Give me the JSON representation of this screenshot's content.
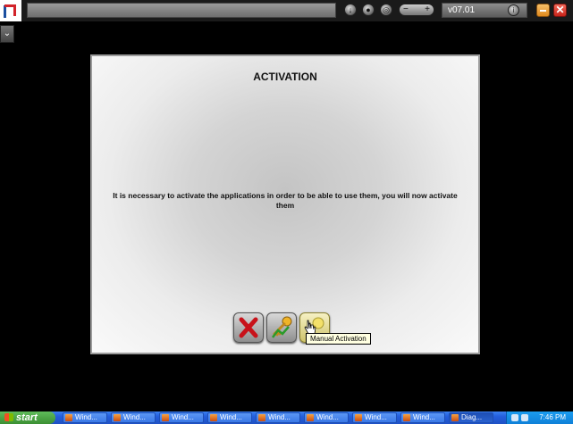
{
  "topbar": {
    "version": "v07.01",
    "close_symbol": "✕",
    "zoom_minus": "−",
    "zoom_plus": "+"
  },
  "dialog": {
    "title": "ACTIVATION",
    "message": "It is necessary to activate the applications in order to be able to use them, you will now activate them",
    "tooltip": "Manual Activation"
  },
  "taskbar": {
    "start_label": "start",
    "tasks": [
      "Wind...",
      "Wind...",
      "Wind...",
      "Wind...",
      "Wind...",
      "Wind...",
      "Wind...",
      "Wind...",
      "Diag..."
    ],
    "clock": "7:46 PM"
  },
  "colors": {
    "brand_red": "#d2232a",
    "brand_blue": "#1b4fa0",
    "taskbar_blue": "#245edc",
    "start_green": "#3b8f33"
  }
}
